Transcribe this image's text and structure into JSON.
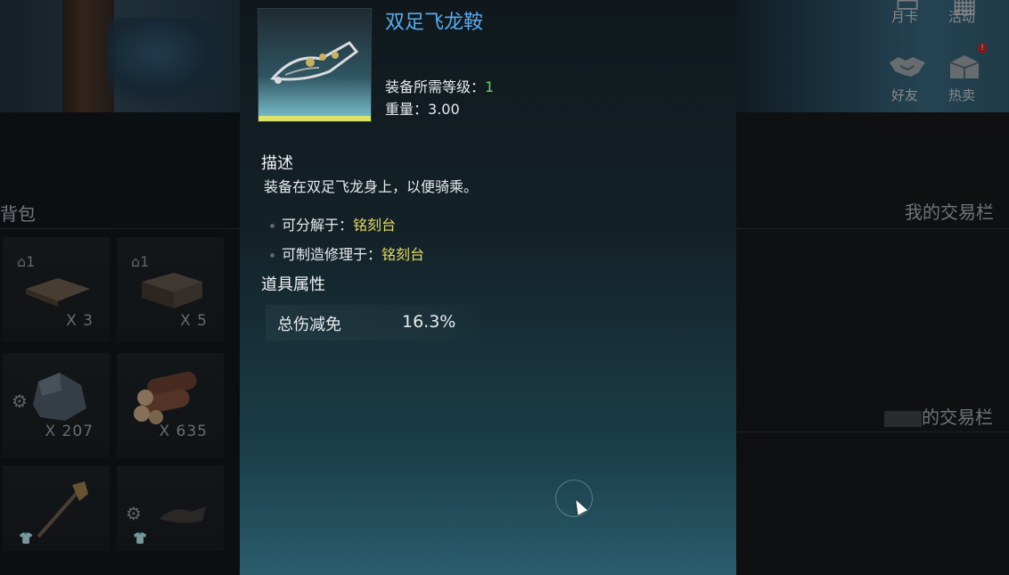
{
  "top_right": {
    "month_card": "月卡",
    "activity": "活动",
    "friends": "好友",
    "hot_sale": "热卖",
    "badge": "!"
  },
  "backpack": {
    "title": "背包",
    "slots": [
      {
        "tier": "1",
        "count": "X 3"
      },
      {
        "tier": "1",
        "count": "X 5"
      },
      {
        "count": "X 207"
      },
      {
        "count": "X 635"
      },
      {},
      {}
    ]
  },
  "trade": {
    "my_label": "我的交易栏",
    "other_label_suffix": "的交易栏"
  },
  "tooltip": {
    "item_name": "双足飞龙鞍",
    "level_label": "装备所需等级：",
    "level_value": "1",
    "weight_label": "重量：",
    "weight_value": "3.00",
    "desc_heading": "描述",
    "desc_text": "装备在双足飞龙身上，以便骑乘。",
    "salvage_label": "可分解于：",
    "salvage_value": "铭刻台",
    "craft_label": "可制造修理于：",
    "craft_value": "铭刻台",
    "props_heading": "道具属性",
    "attr_name": "总伤减免",
    "attr_value": "16.3%"
  },
  "colors": {
    "item_name": "#5aa9ec",
    "highlight": "#e3d86a",
    "level": "#6dd16d",
    "rarity_bar": "#dde36a"
  }
}
